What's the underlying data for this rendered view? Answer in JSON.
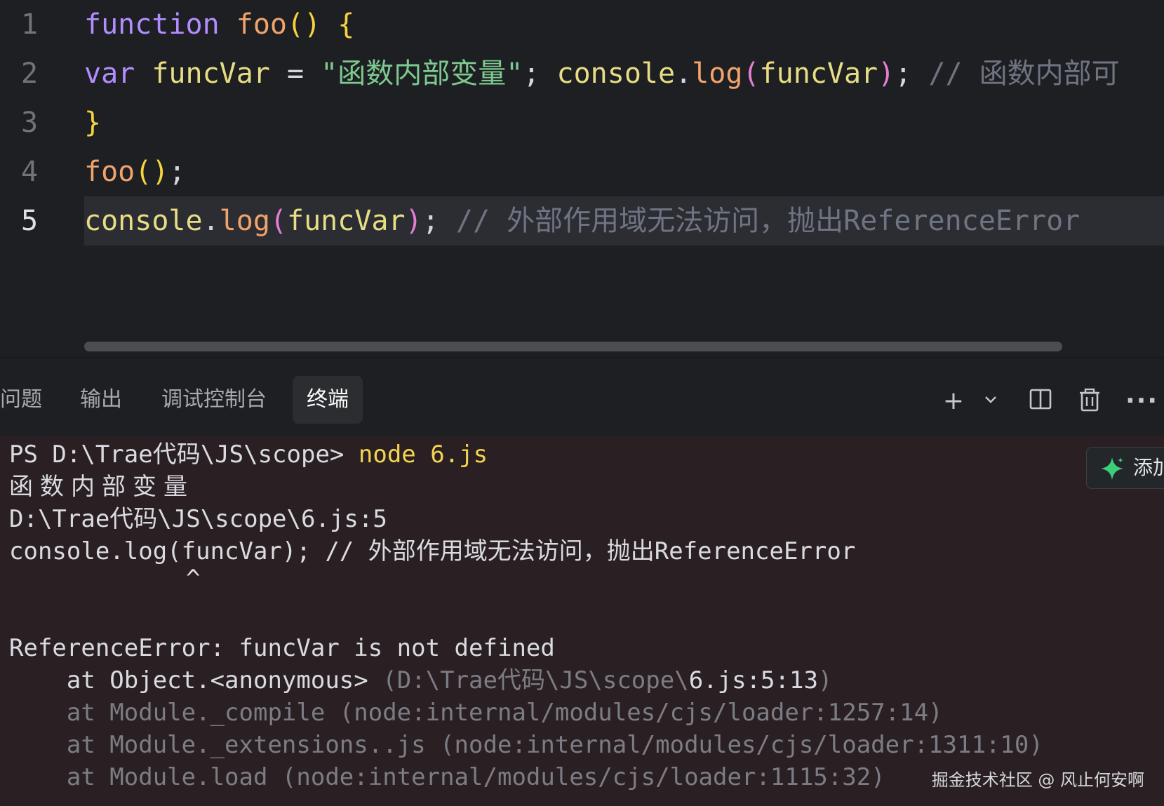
{
  "editor": {
    "lines": [
      {
        "number": "1",
        "tokens": [
          {
            "text": "function",
            "cls": "kw"
          },
          {
            "text": " ",
            "cls": "plain"
          },
          {
            "text": "foo",
            "cls": "fn"
          },
          {
            "text": "()",
            "cls": "brace"
          },
          {
            "text": " ",
            "cls": "plain"
          },
          {
            "text": "{",
            "cls": "brace"
          }
        ]
      },
      {
        "number": "2",
        "tokens": [
          {
            "text": "var",
            "cls": "kw"
          },
          {
            "text": " ",
            "cls": "plain"
          },
          {
            "text": "funcVar",
            "cls": "var"
          },
          {
            "text": " = ",
            "cls": "plain"
          },
          {
            "text": "\"函数内部变量\"",
            "cls": "str"
          },
          {
            "text": "; ",
            "cls": "plain"
          },
          {
            "text": "console",
            "cls": "prop"
          },
          {
            "text": ".",
            "cls": "plain"
          },
          {
            "text": "log",
            "cls": "meth"
          },
          {
            "text": "(",
            "cls": "paren"
          },
          {
            "text": "funcVar",
            "cls": "var"
          },
          {
            "text": ")",
            "cls": "paren"
          },
          {
            "text": "; ",
            "cls": "plain"
          },
          {
            "text": "// 函数内部可",
            "cls": "cmt"
          }
        ]
      },
      {
        "number": "3",
        "tokens": [
          {
            "text": "}",
            "cls": "brace"
          }
        ]
      },
      {
        "number": "4",
        "tokens": [
          {
            "text": "foo",
            "cls": "fn"
          },
          {
            "text": "()",
            "cls": "brace"
          },
          {
            "text": ";",
            "cls": "plain"
          }
        ]
      },
      {
        "number": "5",
        "tokens": [
          {
            "text": "console",
            "cls": "prop"
          },
          {
            "text": ".",
            "cls": "plain"
          },
          {
            "text": "log",
            "cls": "meth"
          },
          {
            "text": "(",
            "cls": "paren"
          },
          {
            "text": "funcVar",
            "cls": "var"
          },
          {
            "text": ")",
            "cls": "paren"
          },
          {
            "text": "; ",
            "cls": "plain"
          },
          {
            "text": "// 外部作用域无法访问，抛出ReferenceError",
            "cls": "cmt"
          }
        ]
      }
    ],
    "current_line": "5"
  },
  "panel": {
    "tabs": [
      {
        "label": "问题",
        "active": false
      },
      {
        "label": "输出",
        "active": false
      },
      {
        "label": "调试控制台",
        "active": false
      },
      {
        "label": "终端",
        "active": true
      }
    ],
    "tools": {
      "add": "+",
      "dropdown": "⌄",
      "split": "split-icon",
      "trash": "trash-icon",
      "more": "···"
    }
  },
  "terminal": {
    "prompt": "PS D:\\Trae代码\\JS\\scope> ",
    "command": "node 6.js",
    "output_line1": "函数内部变量",
    "output_line2": "D:\\Trae代码\\JS\\scope\\6.js:5",
    "output_line3": "console.log(funcVar); // 外部作用域无法访问，抛出ReferenceError",
    "caret": "^",
    "error": "ReferenceError: funcVar is not defined",
    "stack1_at": "    at Object.<anonymous> ",
    "stack1_loc_pre": "(D:\\Trae代码\\JS\\scope\\",
    "stack1_loc_file": "6.js:5:13",
    "stack1_loc_post": ")",
    "stack2": "    at Module._compile (node:internal/modules/cjs/loader:1257:14)",
    "stack3": "    at Module._extensions..js (node:internal/modules/cjs/loader:1311:10)",
    "stack4": "    at Module.load (node:internal/modules/cjs/loader:1115:32)"
  },
  "add_chat_button": {
    "label": "添加"
  },
  "watermark": "掘金技术社区 @ 风止何安啊"
}
